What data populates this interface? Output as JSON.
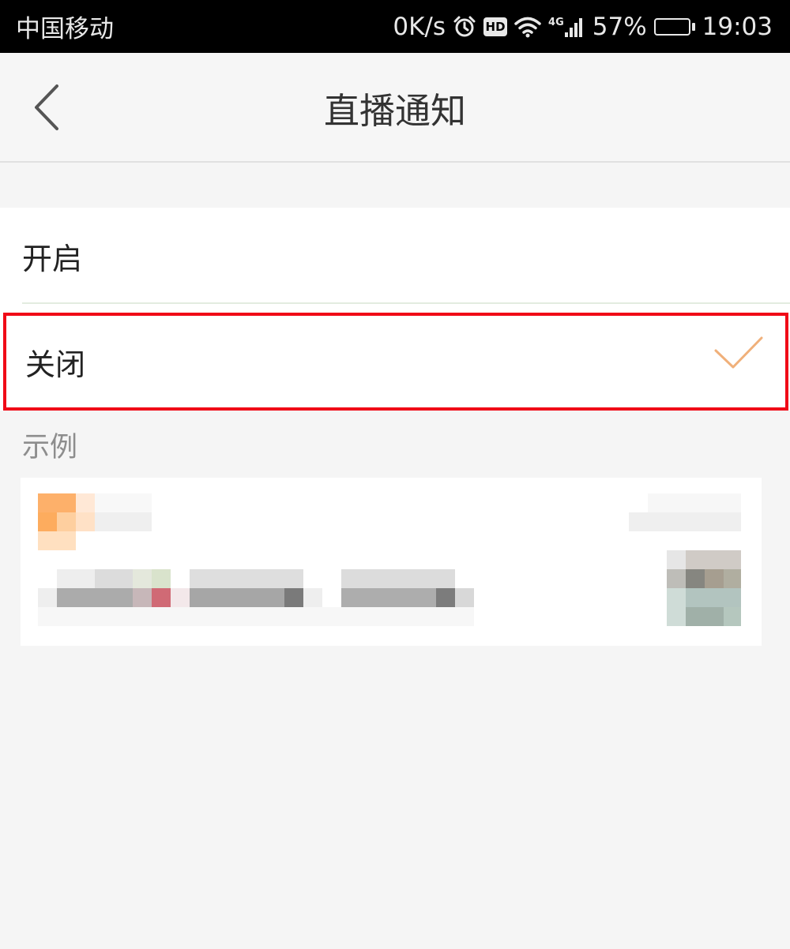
{
  "status_bar": {
    "carrier": "中国移动",
    "speed": "0K/s",
    "hd": "HD",
    "network": "4G",
    "battery": "57%",
    "battery_level": 0.57,
    "time": "19:03"
  },
  "nav": {
    "title": "直播通知",
    "back_icon": "chevron-left-icon"
  },
  "options": [
    {
      "label": "开启",
      "selected": false
    },
    {
      "label": "关闭",
      "selected": true
    }
  ],
  "colors": {
    "accent_check": "#f0b07a",
    "highlight_border": "#f00a17",
    "background": "#f5f5f5"
  },
  "example": {
    "label": "示例"
  }
}
